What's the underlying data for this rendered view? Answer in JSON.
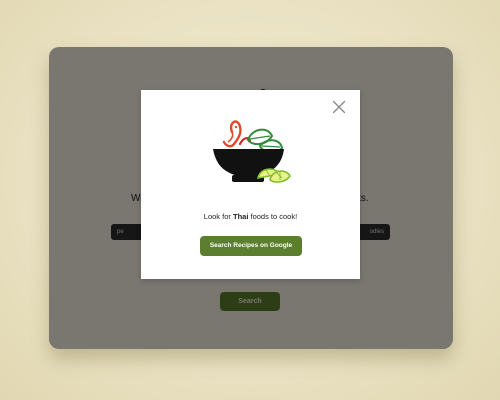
{
  "background_app": {
    "welcome_left": "We",
    "welcome_right": "ts.",
    "chip_left": "pe",
    "chip_right": "odles",
    "search_label": "Search"
  },
  "modal": {
    "prompt_prefix": "Look for ",
    "cuisine": "Thai",
    "prompt_suffix": " foods to cook!",
    "button_label": "Search Recipes on Google",
    "close_icon": "close-icon",
    "illustration_icon": "thai-food-bowl-icon"
  },
  "colors": {
    "accent_green": "#5b7f2e",
    "overlay": "rgba(0,0,0,0.5)",
    "page_background": "#ede5c7"
  }
}
